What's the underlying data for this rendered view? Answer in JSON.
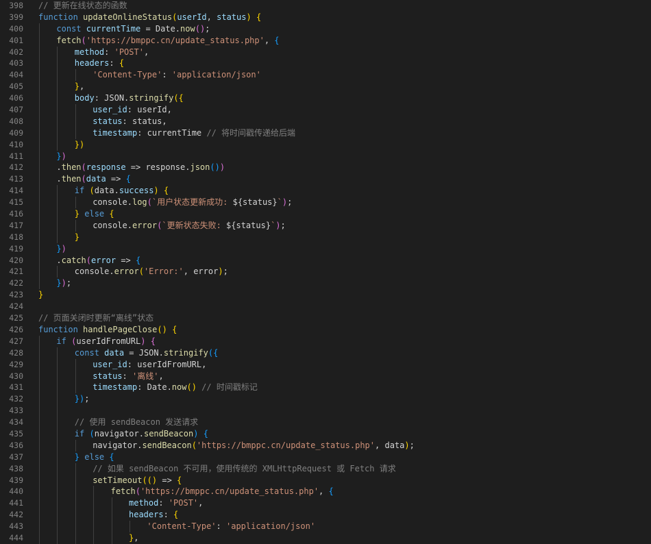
{
  "editor": {
    "lines": [
      {
        "n": "398",
        "indent": 0,
        "tokens": [
          [
            "cmt",
            "// 更新在线状态的函数"
          ]
        ]
      },
      {
        "n": "399",
        "indent": 0,
        "tokens": [
          [
            "kw",
            "function "
          ],
          [
            "fn",
            "updateOnlineStatus"
          ],
          [
            "br1",
            "("
          ],
          [
            "var",
            "userId"
          ],
          [
            "pl",
            ", "
          ],
          [
            "var",
            "status"
          ],
          [
            "br1",
            ")"
          ],
          [
            "pl",
            " "
          ],
          [
            "br1",
            "{"
          ]
        ]
      },
      {
        "n": "400",
        "indent": 1,
        "tokens": [
          [
            "kw",
            "const "
          ],
          [
            "var",
            "currentTime"
          ],
          [
            "pl",
            " = Date."
          ],
          [
            "fn",
            "now"
          ],
          [
            "br2",
            "()"
          ],
          [
            "pl",
            ";"
          ]
        ]
      },
      {
        "n": "401",
        "indent": 1,
        "tokens": [
          [
            "fn",
            "fetch"
          ],
          [
            "br2",
            "("
          ],
          [
            "str",
            "'https://bmppc.cn/update_status.php'"
          ],
          [
            "pl",
            ", "
          ],
          [
            "br3",
            "{"
          ]
        ]
      },
      {
        "n": "402",
        "indent": 2,
        "tokens": [
          [
            "prop",
            "method"
          ],
          [
            "pl",
            ": "
          ],
          [
            "str",
            "'POST'"
          ],
          [
            "pl",
            ","
          ]
        ]
      },
      {
        "n": "403",
        "indent": 2,
        "tokens": [
          [
            "prop",
            "headers"
          ],
          [
            "pl",
            ": "
          ],
          [
            "br1",
            "{"
          ]
        ]
      },
      {
        "n": "404",
        "indent": 3,
        "tokens": [
          [
            "str",
            "'Content-Type'"
          ],
          [
            "pl",
            ": "
          ],
          [
            "str",
            "'application/json'"
          ]
        ]
      },
      {
        "n": "405",
        "indent": 2,
        "tokens": [
          [
            "br1",
            "}"
          ],
          [
            "pl",
            ","
          ]
        ]
      },
      {
        "n": "406",
        "indent": 2,
        "tokens": [
          [
            "prop",
            "body"
          ],
          [
            "pl",
            ": JSON."
          ],
          [
            "fn",
            "stringify"
          ],
          [
            "br1",
            "({"
          ]
        ]
      },
      {
        "n": "407",
        "indent": 3,
        "tokens": [
          [
            "prop",
            "user_id"
          ],
          [
            "pl",
            ": userId,"
          ]
        ]
      },
      {
        "n": "408",
        "indent": 3,
        "tokens": [
          [
            "prop",
            "status"
          ],
          [
            "pl",
            ": status,"
          ]
        ]
      },
      {
        "n": "409",
        "indent": 3,
        "tokens": [
          [
            "prop",
            "timestamp"
          ],
          [
            "pl",
            ": currentTime "
          ],
          [
            "cmt",
            "// 将时间戳传递给后端"
          ]
        ]
      },
      {
        "n": "410",
        "indent": 2,
        "tokens": [
          [
            "br1",
            "})"
          ]
        ]
      },
      {
        "n": "411",
        "indent": 1,
        "tokens": [
          [
            "br3",
            "}"
          ],
          [
            "br2",
            ")"
          ]
        ]
      },
      {
        "n": "412",
        "indent": 1,
        "tokens": [
          [
            "pl",
            "."
          ],
          [
            "fn",
            "then"
          ],
          [
            "br2",
            "("
          ],
          [
            "var",
            "response"
          ],
          [
            "pl",
            " => response."
          ],
          [
            "fn",
            "json"
          ],
          [
            "br3",
            "()"
          ],
          [
            "br2",
            ")"
          ]
        ]
      },
      {
        "n": "413",
        "indent": 1,
        "tokens": [
          [
            "pl",
            "."
          ],
          [
            "fn",
            "then"
          ],
          [
            "br2",
            "("
          ],
          [
            "var",
            "data"
          ],
          [
            "pl",
            " => "
          ],
          [
            "br3",
            "{"
          ]
        ]
      },
      {
        "n": "414",
        "indent": 2,
        "tokens": [
          [
            "kw",
            "if "
          ],
          [
            "br1",
            "("
          ],
          [
            "pl",
            "data."
          ],
          [
            "prop",
            "success"
          ],
          [
            "br1",
            ")"
          ],
          [
            "pl",
            " "
          ],
          [
            "br1",
            "{"
          ]
        ]
      },
      {
        "n": "415",
        "indent": 3,
        "tokens": [
          [
            "pl",
            "console."
          ],
          [
            "fn",
            "log"
          ],
          [
            "br2",
            "("
          ],
          [
            "tpl",
            "`用户状态更新成功: "
          ],
          [
            "pl",
            "${status}"
          ],
          [
            "tpl",
            "`"
          ],
          [
            "br2",
            ")"
          ],
          [
            "pl",
            ";"
          ]
        ]
      },
      {
        "n": "416",
        "indent": 2,
        "tokens": [
          [
            "br1",
            "}"
          ],
          [
            "kw",
            " else "
          ],
          [
            "br1",
            "{"
          ]
        ]
      },
      {
        "n": "417",
        "indent": 3,
        "tokens": [
          [
            "pl",
            "console."
          ],
          [
            "fn",
            "error"
          ],
          [
            "br2",
            "("
          ],
          [
            "tpl",
            "`更新状态失败: "
          ],
          [
            "pl",
            "${status}"
          ],
          [
            "tpl",
            "`"
          ],
          [
            "br2",
            ")"
          ],
          [
            "pl",
            ";"
          ]
        ]
      },
      {
        "n": "418",
        "indent": 2,
        "tokens": [
          [
            "br1",
            "}"
          ]
        ]
      },
      {
        "n": "419",
        "indent": 1,
        "tokens": [
          [
            "br3",
            "}"
          ],
          [
            "br2",
            ")"
          ]
        ]
      },
      {
        "n": "420",
        "indent": 1,
        "tokens": [
          [
            "pl",
            "."
          ],
          [
            "fn",
            "catch"
          ],
          [
            "br2",
            "("
          ],
          [
            "var",
            "error"
          ],
          [
            "pl",
            " => "
          ],
          [
            "br3",
            "{"
          ]
        ]
      },
      {
        "n": "421",
        "indent": 2,
        "tokens": [
          [
            "pl",
            "console."
          ],
          [
            "fn",
            "error"
          ],
          [
            "br1",
            "("
          ],
          [
            "str",
            "'Error:'"
          ],
          [
            "pl",
            ", error"
          ],
          [
            "br1",
            ")"
          ],
          [
            "pl",
            ";"
          ]
        ]
      },
      {
        "n": "422",
        "indent": 1,
        "tokens": [
          [
            "br3",
            "}"
          ],
          [
            "br2",
            ")"
          ],
          [
            "pl",
            ";"
          ]
        ]
      },
      {
        "n": "423",
        "indent": 0,
        "tokens": [
          [
            "br1",
            "}"
          ]
        ]
      },
      {
        "n": "424",
        "indent": 0,
        "tokens": []
      },
      {
        "n": "425",
        "indent": 0,
        "tokens": [
          [
            "cmt",
            "// 页面关闭时更新“离线”状态"
          ]
        ]
      },
      {
        "n": "426",
        "indent": 0,
        "tokens": [
          [
            "kw",
            "function "
          ],
          [
            "fn",
            "handlePageClose"
          ],
          [
            "br1",
            "()"
          ],
          [
            "pl",
            " "
          ],
          [
            "br1",
            "{"
          ]
        ]
      },
      {
        "n": "427",
        "indent": 1,
        "tokens": [
          [
            "kw",
            "if "
          ],
          [
            "br2",
            "("
          ],
          [
            "pl",
            "userIdFromURL"
          ],
          [
            "br2",
            ")"
          ],
          [
            "pl",
            " "
          ],
          [
            "br2",
            "{"
          ]
        ]
      },
      {
        "n": "428",
        "indent": 2,
        "tokens": [
          [
            "kw",
            "const "
          ],
          [
            "var",
            "data"
          ],
          [
            "pl",
            " = JSON."
          ],
          [
            "fn",
            "stringify"
          ],
          [
            "br3",
            "({"
          ]
        ]
      },
      {
        "n": "429",
        "indent": 3,
        "tokens": [
          [
            "prop",
            "user_id"
          ],
          [
            "pl",
            ": userIdFromURL,"
          ]
        ]
      },
      {
        "n": "430",
        "indent": 3,
        "tokens": [
          [
            "prop",
            "status"
          ],
          [
            "pl",
            ": "
          ],
          [
            "str",
            "'离线'"
          ],
          [
            "pl",
            ","
          ]
        ]
      },
      {
        "n": "431",
        "indent": 3,
        "tokens": [
          [
            "prop",
            "timestamp"
          ],
          [
            "pl",
            ": Date."
          ],
          [
            "fn",
            "now"
          ],
          [
            "br1",
            "()"
          ],
          [
            "pl",
            " "
          ],
          [
            "cmt",
            "// 时间戳标记"
          ]
        ]
      },
      {
        "n": "432",
        "indent": 2,
        "tokens": [
          [
            "br3",
            "})"
          ],
          [
            "pl",
            ";"
          ]
        ]
      },
      {
        "n": "433",
        "indent": 2,
        "tokens": []
      },
      {
        "n": "434",
        "indent": 2,
        "tokens": [
          [
            "cmt",
            "// 使用 sendBeacon 发送请求"
          ]
        ]
      },
      {
        "n": "435",
        "indent": 2,
        "tokens": [
          [
            "kw",
            "if "
          ],
          [
            "br3",
            "("
          ],
          [
            "pl",
            "navigator."
          ],
          [
            "fn",
            "sendBeacon"
          ],
          [
            "br3",
            ")"
          ],
          [
            "pl",
            " "
          ],
          [
            "br3",
            "{"
          ]
        ]
      },
      {
        "n": "436",
        "indent": 3,
        "tokens": [
          [
            "pl",
            "navigator."
          ],
          [
            "fn",
            "sendBeacon"
          ],
          [
            "br1",
            "("
          ],
          [
            "str",
            "'https://bmppc.cn/update_status.php'"
          ],
          [
            "pl",
            ", data"
          ],
          [
            "br1",
            ")"
          ],
          [
            "pl",
            ";"
          ]
        ]
      },
      {
        "n": "437",
        "indent": 2,
        "tokens": [
          [
            "br3",
            "}"
          ],
          [
            "kw",
            " else "
          ],
          [
            "br3",
            "{"
          ]
        ]
      },
      {
        "n": "438",
        "indent": 3,
        "tokens": [
          [
            "cmt",
            "// 如果 sendBeacon 不可用，使用传统的 XMLHttpRequest 或 Fetch 请求"
          ]
        ]
      },
      {
        "n": "439",
        "indent": 3,
        "tokens": [
          [
            "fn",
            "setTimeout"
          ],
          [
            "br1",
            "(()"
          ],
          [
            "pl",
            " => "
          ],
          [
            "br1",
            "{"
          ]
        ]
      },
      {
        "n": "440",
        "indent": 4,
        "tokens": [
          [
            "fn",
            "fetch"
          ],
          [
            "br2",
            "("
          ],
          [
            "str",
            "'https://bmppc.cn/update_status.php'"
          ],
          [
            "pl",
            ", "
          ],
          [
            "br3",
            "{"
          ]
        ]
      },
      {
        "n": "441",
        "indent": 5,
        "tokens": [
          [
            "prop",
            "method"
          ],
          [
            "pl",
            ": "
          ],
          [
            "str",
            "'POST'"
          ],
          [
            "pl",
            ","
          ]
        ]
      },
      {
        "n": "442",
        "indent": 5,
        "tokens": [
          [
            "prop",
            "headers"
          ],
          [
            "pl",
            ": "
          ],
          [
            "br1",
            "{"
          ]
        ]
      },
      {
        "n": "443",
        "indent": 6,
        "tokens": [
          [
            "str",
            "'Content-Type'"
          ],
          [
            "pl",
            ": "
          ],
          [
            "str",
            "'application/json'"
          ]
        ]
      },
      {
        "n": "444",
        "indent": 5,
        "tokens": [
          [
            "br1",
            "}"
          ],
          [
            "pl",
            ","
          ]
        ]
      }
    ]
  }
}
